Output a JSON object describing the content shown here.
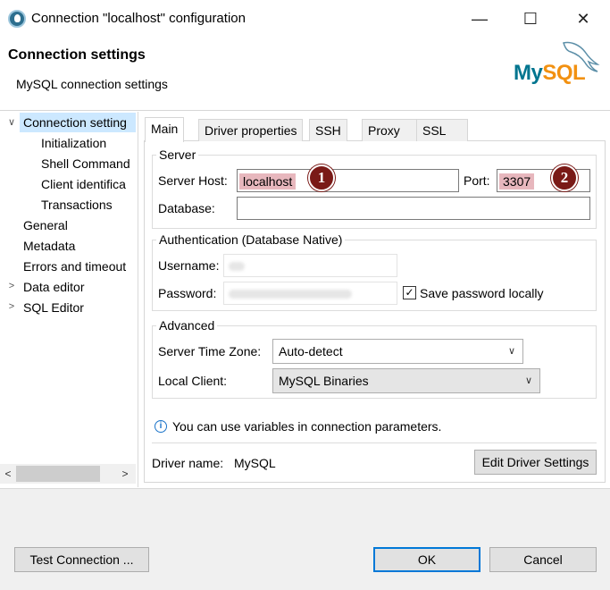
{
  "window": {
    "title": "Connection \"localhost\" configuration",
    "minimize": "—",
    "maximize": "☐",
    "close": "✕"
  },
  "header": {
    "title": "Connection settings",
    "subtitle": "MySQL connection settings",
    "logo_text_my": "My",
    "logo_text_sql": "SQL"
  },
  "tree": {
    "items": [
      {
        "label": "Connection setting",
        "expanded": true,
        "selected": true
      },
      {
        "label": "Initialization"
      },
      {
        "label": "Shell Command"
      },
      {
        "label": "Client identifica"
      },
      {
        "label": "Transactions"
      },
      {
        "label": "General"
      },
      {
        "label": "Metadata"
      },
      {
        "label": "Errors and timeout"
      },
      {
        "label": "Data editor",
        "collapsed": true
      },
      {
        "label": "SQL Editor",
        "collapsed": true
      }
    ]
  },
  "tabs": [
    "Main",
    "Driver properties",
    "SSH",
    "Proxy",
    "SSL"
  ],
  "server": {
    "legend": "Server",
    "host_label": "Server Host:",
    "host_value": "localhost",
    "port_label": "Port:",
    "port_value": "3307",
    "database_label": "Database:",
    "database_value": "",
    "badge1": "1",
    "badge2": "2"
  },
  "auth": {
    "legend": "Authentication (Database Native)",
    "username_label": "Username:",
    "password_label": "Password:",
    "save_password_label": "Save password locally",
    "save_password_checked": true,
    "checkmark": "✓"
  },
  "advanced": {
    "legend": "Advanced",
    "timezone_label": "Server Time Zone:",
    "timezone_value": "Auto-detect",
    "local_client_label": "Local Client:",
    "local_client_value": "MySQL Binaries"
  },
  "info": {
    "icon": "i",
    "text": "You can use variables in connection parameters."
  },
  "driver": {
    "label": "Driver name:",
    "value": "MySQL",
    "edit_button": "Edit Driver Settings"
  },
  "footer": {
    "test_button": "Test Connection ...",
    "ok_button": "OK",
    "cancel_button": "Cancel"
  },
  "glyphs": {
    "expanded": "∨",
    "collapsed": ">",
    "scroll_left": "<",
    "scroll_right": ">",
    "dropdown": "∨"
  }
}
